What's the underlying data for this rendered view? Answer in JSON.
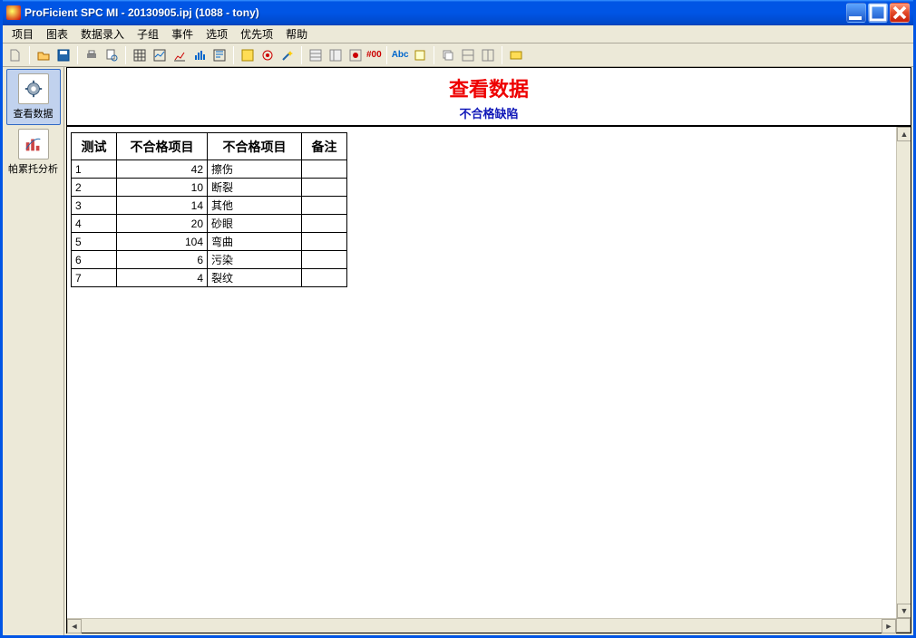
{
  "window": {
    "title": "ProFicient SPC MI - 20130905.ipj (1088 - tony)"
  },
  "menu": [
    "项目",
    "图表",
    "数据录入",
    "子组",
    "事件",
    "选项",
    "优先项",
    "帮助"
  ],
  "sidebar": {
    "items": [
      {
        "label": "查看数据"
      },
      {
        "label": "帕累托分析"
      }
    ]
  },
  "doc": {
    "title": "查看数据",
    "subtitle": "不合格缺陷"
  },
  "table": {
    "headers": [
      "测试",
      "不合格项目",
      "不合格项目",
      "备注"
    ],
    "rows": [
      {
        "idx": "1",
        "count": "42",
        "defect": "擦伤",
        "remark": ""
      },
      {
        "idx": "2",
        "count": "10",
        "defect": "断裂",
        "remark": ""
      },
      {
        "idx": "3",
        "count": "14",
        "defect": "其他",
        "remark": ""
      },
      {
        "idx": "4",
        "count": "20",
        "defect": "砂眼",
        "remark": ""
      },
      {
        "idx": "5",
        "count": "104",
        "defect": "弯曲",
        "remark": ""
      },
      {
        "idx": "6",
        "count": "6",
        "defect": "污染",
        "remark": ""
      },
      {
        "idx": "7",
        "count": "4",
        "defect": "裂纹",
        "remark": ""
      }
    ]
  },
  "toolbar": {
    "label_hash00": "#00",
    "label_abc": "Abc"
  }
}
